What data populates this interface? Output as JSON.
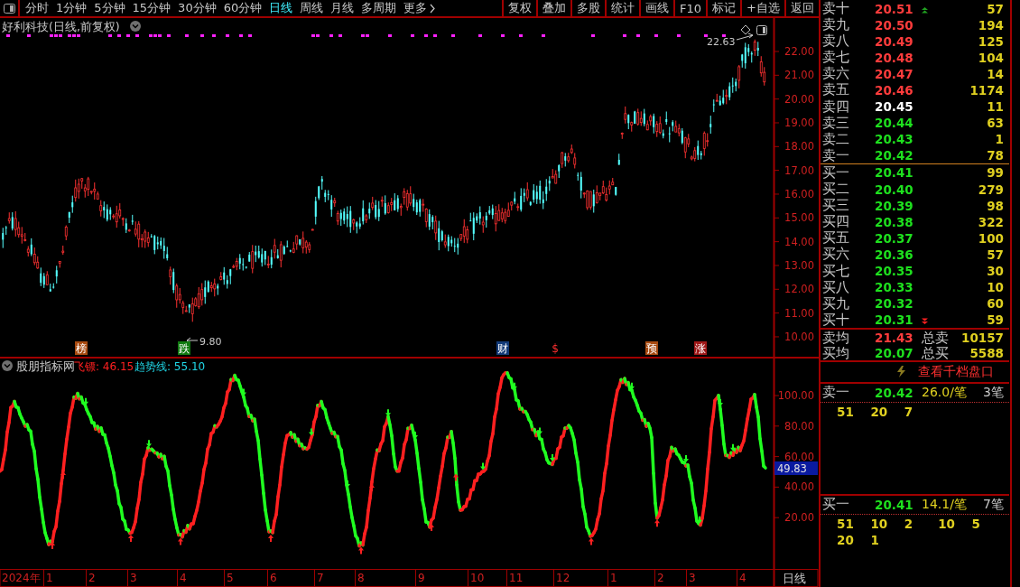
{
  "toolbar": {
    "periods": [
      {
        "label": "分时",
        "selected": false
      },
      {
        "label": "1分钟",
        "selected": false
      },
      {
        "label": "5分钟",
        "selected": false
      },
      {
        "label": "15分钟",
        "selected": false
      },
      {
        "label": "30分钟",
        "selected": false
      },
      {
        "label": "60分钟",
        "selected": false
      },
      {
        "label": "日线",
        "selected": true
      },
      {
        "label": "周线",
        "selected": false
      },
      {
        "label": "月线",
        "selected": false
      },
      {
        "label": "多周期",
        "selected": false
      },
      {
        "label": "更多",
        "selected": false
      }
    ],
    "buttons": [
      "复权",
      "叠加",
      "多股",
      "统计",
      "画线",
      "F10",
      "标记",
      "+自选",
      "返回"
    ]
  },
  "price_chart": {
    "title": "好利科技(日线,前复权)",
    "y_ticks": [
      "22.00",
      "21.00",
      "20.00",
      "19.00",
      "18.00",
      "17.00",
      "16.00",
      "15.00",
      "14.00",
      "13.00",
      "12.00",
      "11.00",
      "10.00"
    ],
    "high_label": "22.63",
    "low_label": "9.80",
    "events": [
      {
        "label": "榜",
        "kind": "badge",
        "color": "#a84a10"
      },
      {
        "label": "跌",
        "kind": "badge",
        "color": "#107a10"
      },
      {
        "label": "财",
        "kind": "badge",
        "color": "#123a78"
      },
      {
        "label": "$",
        "kind": "text",
        "color": "#ff3030"
      },
      {
        "label": "预",
        "kind": "badge",
        "color": "#a84a10"
      },
      {
        "label": "涨",
        "kind": "badge",
        "color": "#a01818"
      }
    ]
  },
  "indicator": {
    "name": "股朋指标网",
    "series": [
      {
        "label": "飞镖: 46.15",
        "color": "#ff2020"
      },
      {
        "label": "趋势线: 55.10",
        "color": "#20d8e8"
      }
    ],
    "y_ticks": [
      "100.00",
      "80.00",
      "60.00",
      "40.00",
      "20.00"
    ],
    "current_value": "49.83"
  },
  "time_axis": {
    "year": "2024年",
    "months": [
      "1",
      "2",
      "3",
      "4",
      "5",
      "6",
      "7",
      "8",
      "9",
      "10",
      "11",
      "12",
      "1",
      "2",
      "3",
      "4"
    ],
    "period": "日线"
  },
  "order_book": {
    "asks": [
      {
        "label": "卖十",
        "price": "20.51",
        "volume": "57",
        "color": "#ff3c3c",
        "arrow_up": true
      },
      {
        "label": "卖九",
        "price": "20.50",
        "volume": "194",
        "color": "#ff3c3c"
      },
      {
        "label": "卖八",
        "price": "20.49",
        "volume": "125",
        "color": "#ff3c3c"
      },
      {
        "label": "卖七",
        "price": "20.48",
        "volume": "104",
        "color": "#ff3c3c"
      },
      {
        "label": "卖六",
        "price": "20.47",
        "volume": "14",
        "color": "#ff3c3c"
      },
      {
        "label": "卖五",
        "price": "20.46",
        "volume": "1174",
        "color": "#ff3c3c"
      },
      {
        "label": "卖四",
        "price": "20.45",
        "volume": "11",
        "color": "#ffffff"
      },
      {
        "label": "卖三",
        "price": "20.44",
        "volume": "63",
        "color": "#1ee01e"
      },
      {
        "label": "卖二",
        "price": "20.43",
        "volume": "1",
        "color": "#1ee01e"
      },
      {
        "label": "卖一",
        "price": "20.42",
        "volume": "78",
        "color": "#1ee01e"
      }
    ],
    "bids": [
      {
        "label": "买一",
        "price": "20.41",
        "volume": "99",
        "color": "#1ee01e"
      },
      {
        "label": "买二",
        "price": "20.40",
        "volume": "279",
        "color": "#1ee01e"
      },
      {
        "label": "买三",
        "price": "20.39",
        "volume": "98",
        "color": "#1ee01e"
      },
      {
        "label": "买四",
        "price": "20.38",
        "volume": "322",
        "color": "#1ee01e"
      },
      {
        "label": "买五",
        "price": "20.37",
        "volume": "100",
        "color": "#1ee01e"
      },
      {
        "label": "买六",
        "price": "20.36",
        "volume": "57",
        "color": "#1ee01e"
      },
      {
        "label": "买七",
        "price": "20.35",
        "volume": "30",
        "color": "#1ee01e"
      },
      {
        "label": "买八",
        "price": "20.33",
        "volume": "10",
        "color": "#1ee01e"
      },
      {
        "label": "买九",
        "price": "20.32",
        "volume": "60",
        "color": "#1ee01e"
      },
      {
        "label": "买十",
        "price": "20.31",
        "volume": "59",
        "color": "#1ee01e",
        "arrow_down": true
      }
    ],
    "summary": [
      {
        "label": "卖均",
        "price": "21.43",
        "total_label": "总卖",
        "total": "10157",
        "color": "#ff3c3c"
      },
      {
        "label": "买均",
        "price": "20.07",
        "total_label": "总买",
        "total": "5588",
        "color": "#1ee01e"
      }
    ],
    "depth_link": "查看千档盘口",
    "best_quotes": [
      {
        "label": "卖一",
        "price": "20.42",
        "per_trade": "26.0/笔",
        "count": "3笔",
        "queue": [
          "51",
          "20",
          "7"
        ]
      },
      {
        "label": "买一",
        "price": "20.41",
        "per_trade": "14.1/笔",
        "count": "7笔",
        "queue": [
          "51",
          "10",
          "2",
          "10",
          "5",
          "20",
          "1"
        ]
      }
    ]
  }
}
